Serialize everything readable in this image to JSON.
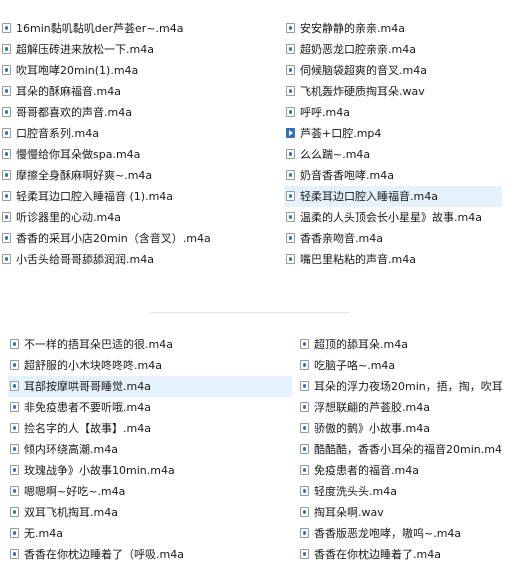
{
  "top": {
    "left": [
      {
        "name": "16min黏叽黏叽der芦荟er~.m4a",
        "type": "audio"
      },
      {
        "name": "超解压砖进来放松一下.m4a",
        "type": "audio"
      },
      {
        "name": "吹耳咆哮20min(1).m4a",
        "type": "audio"
      },
      {
        "name": "耳朵的酥麻福音.m4a",
        "type": "audio"
      },
      {
        "name": "哥哥都喜欢的声音.m4a",
        "type": "audio"
      },
      {
        "name": "口腔音系列.m4a",
        "type": "audio"
      },
      {
        "name": "慢慢给你耳朵做spa.m4a",
        "type": "audio"
      },
      {
        "name": "摩擦全身酥麻啊好爽~.m4a",
        "type": "audio"
      },
      {
        "name": "轻柔耳边口腔入睡福音 (1).m4a",
        "type": "audio"
      },
      {
        "name": "听诊器里的心动.m4a",
        "type": "audio"
      },
      {
        "name": "香香的采耳小店20min（含音叉）.m4a",
        "type": "audio"
      },
      {
        "name": "小舌头给哥哥舔舔润润.m4a",
        "type": "audio"
      }
    ],
    "right": [
      {
        "name": "安安静静的亲亲.m4a",
        "type": "audio"
      },
      {
        "name": "超奶恶龙口腔亲亲.m4a",
        "type": "audio"
      },
      {
        "name": "伺候脑袋超爽的音叉.m4a",
        "type": "audio"
      },
      {
        "name": "飞机轰炸硬质掏耳朵.wav",
        "type": "audio"
      },
      {
        "name": "呼呼.m4a",
        "type": "audio"
      },
      {
        "name": "芦荟+口腔.mp4",
        "type": "video"
      },
      {
        "name": "么么踹~.m4a",
        "type": "audio"
      },
      {
        "name": "奶音香香咆哮.m4a",
        "type": "audio"
      },
      {
        "name": "轻柔耳边口腔入睡福音.m4a",
        "type": "audio",
        "selected": true
      },
      {
        "name": "温柔的人头顶会长小星星》故事.m4a",
        "type": "audio"
      },
      {
        "name": "香香亲吻音.m4a",
        "type": "audio"
      },
      {
        "name": "嘴巴里粘粘的声音.m4a",
        "type": "audio"
      }
    ]
  },
  "bottom": {
    "left": [
      {
        "name": "不一样的捂耳朵巴适的很.m4a",
        "type": "audio"
      },
      {
        "name": "超舒服的小木块咚咚咚.m4a",
        "type": "audio"
      },
      {
        "name": "耳部按摩哄哥哥睡觉.m4a",
        "type": "audio",
        "selected": true
      },
      {
        "name": "非免疫患者不要听哦.m4a",
        "type": "audio"
      },
      {
        "name": "捡名字的人【故事】.m4a",
        "type": "audio"
      },
      {
        "name": "倾内环绕高潮.m4a",
        "type": "audio"
      },
      {
        "name": "玫瑰战争》小故事10min.m4a",
        "type": "audio"
      },
      {
        "name": "嗯嗯啊~好吃~.m4a",
        "type": "audio"
      },
      {
        "name": "双耳飞机掏耳.m4a",
        "type": "audio"
      },
      {
        "name": "无.m4a",
        "type": "audio"
      },
      {
        "name": "香香在你枕边睡着了（呼吸.m4a",
        "type": "audio"
      }
    ],
    "right": [
      {
        "name": "超顶的舔耳朵.m4a",
        "type": "audio"
      },
      {
        "name": "吃脑子咯~.m4a",
        "type": "audio"
      },
      {
        "name": "耳朵的浮力夜场20min，捂，掏，吹耳",
        "type": "audio"
      },
      {
        "name": "浮想联翩的芦荟胶.m4a",
        "type": "audio"
      },
      {
        "name": "骄傲的鹅》小故事.m4a",
        "type": "audio"
      },
      {
        "name": "酷酷酷，香香小耳朵的福音20min.m4",
        "type": "audio"
      },
      {
        "name": "免疫患者的福音.m4a",
        "type": "audio"
      },
      {
        "name": "轻度洗头头.m4a",
        "type": "audio"
      },
      {
        "name": "掏耳朵啊.wav",
        "type": "audio"
      },
      {
        "name": "香香版恶龙咆哮，嗷呜~.m4a",
        "type": "audio"
      },
      {
        "name": "香香在你枕边睡着了.m4a",
        "type": "audio"
      }
    ]
  }
}
